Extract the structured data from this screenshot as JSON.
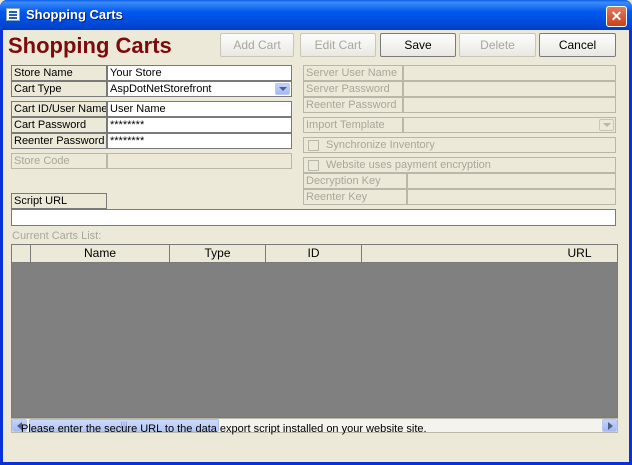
{
  "window": {
    "title": "Shopping Carts",
    "close_glyph": "✕"
  },
  "header": {
    "app_title": "Shopping Carts"
  },
  "toolbar": {
    "add_cart": "Add Cart",
    "edit_cart": "Edit Cart",
    "save": "Save",
    "delete": "Delete",
    "cancel": "Cancel"
  },
  "form": {
    "store_name_label": "Store Name",
    "store_name_value": "Your Store",
    "cart_type_label": "Cart Type",
    "cart_type_value": "AspDotNetStorefront",
    "cart_id_label": "Cart ID/User Name",
    "cart_id_value": "User Name",
    "cart_password_label": "Cart Password",
    "cart_password_value": "********",
    "reenter_password_label": "Reenter Password",
    "reenter_password_value": "********",
    "store_code_label": "Store Code",
    "store_code_value": "",
    "script_url_label": "Script URL",
    "script_url_value": ""
  },
  "server": {
    "server_user_label": "Server User Name",
    "server_password_label": "Server Password",
    "server_reenter_label": "Reenter Password",
    "import_template_label": "Import Template",
    "sync_inventory_label": "Synchronize Inventory",
    "encryption_label": "Website uses payment encryption",
    "decryption_key_label": "Decryption Key",
    "reenter_key_label": "Reenter Key"
  },
  "carts_list": {
    "label": "Current Carts List:",
    "columns": [
      "Name",
      "Type",
      "ID",
      "URL"
    ]
  },
  "status": {
    "message": "Please enter the secure URL to the data export script installed on your website site."
  },
  "icons": {
    "window_icon": "form-icon",
    "combo": "chevron-down-icon",
    "scroll_left": "arrow-left-icon",
    "scroll_right": "arrow-right-icon",
    "scroll_grip": "grip-icon"
  },
  "colors": {
    "title_color": "#7d0b0b",
    "grid_background": "#808080",
    "titlebar_blue": "#0058ee",
    "close_red": "#c8401c"
  }
}
